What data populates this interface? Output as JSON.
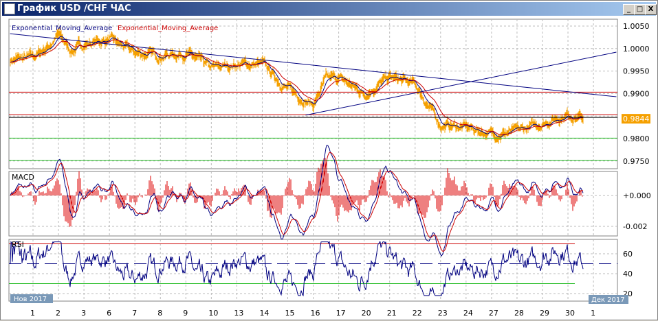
{
  "window": {
    "title": "График USD /CHF ЧАС",
    "minimize": "_",
    "maximize": "□",
    "close": "X"
  },
  "main": {
    "legend1": "Exponential_Moving_Average",
    "legend2": "Exponential_Moving_Average",
    "price_labels": [
      "1.0050",
      "1.0000",
      "0.9950",
      "0.9900",
      "0.9800",
      "0.9750"
    ],
    "price_values": [
      1.005,
      1.0,
      0.995,
      0.99,
      0.98,
      0.975
    ],
    "current_price": "0.9844",
    "colors": {
      "bars": "#f5a000",
      "ema1": "#000080",
      "ema2": "#cc0000",
      "current": "#f5a000"
    },
    "hlines": [
      {
        "price": 0.9903,
        "color": "#cc0000"
      },
      {
        "price": 0.9853,
        "color": "#cc0000"
      },
      {
        "price": 0.9847,
        "color": "#000000"
      },
      {
        "price": 0.9801,
        "color": "#22bb22"
      },
      {
        "price": 0.9752,
        "color": "#22bb22"
      }
    ],
    "trendlines": [
      {
        "from": [
          -0.9,
          1.0033
        ],
        "to": [
          22.9,
          0.9893
        ]
      },
      {
        "from": [
          10.7,
          0.9852
        ],
        "to": [
          22.9,
          0.9992
        ]
      }
    ]
  },
  "macd": {
    "label": "MACD",
    "tick_labels": [
      "+0.000",
      "-0.002"
    ]
  },
  "rsi": {
    "label": "RSI",
    "tick_labels": [
      "60",
      "40",
      "20"
    ],
    "levels": [
      70,
      50,
      30
    ]
  },
  "xaxis": {
    "month_left": "Нов 2017",
    "month_right": "Дек 2017",
    "days": [
      "1",
      "2",
      "3",
      "6",
      "7",
      "8",
      "9",
      "10",
      "13",
      "14",
      "15",
      "16",
      "17",
      "20",
      "21",
      "22",
      "23",
      "24",
      "27",
      "28",
      "29",
      "30",
      "1"
    ]
  },
  "chart_data": {
    "type": "line",
    "title": "USD/CHF H1",
    "price_anchors": [
      [
        -0.9,
        0.9975
      ],
      [
        0,
        0.998
      ],
      [
        0.6,
        1.0005
      ],
      [
        1,
        1.003
      ],
      [
        1.5,
        0.9995
      ],
      [
        2,
        1.001
      ],
      [
        3,
        1.002
      ],
      [
        4,
        0.999
      ],
      [
        5,
        0.9985
      ],
      [
        6,
        0.999
      ],
      [
        7,
        0.9955
      ],
      [
        8,
        0.9965
      ],
      [
        9,
        0.9965
      ],
      [
        10,
        0.991
      ],
      [
        11,
        0.9875
      ],
      [
        11.5,
        0.993
      ],
      [
        12,
        0.9935
      ],
      [
        13,
        0.99
      ],
      [
        14,
        0.9935
      ],
      [
        15,
        0.992
      ],
      [
        16,
        0.983
      ],
      [
        17,
        0.9825
      ],
      [
        18,
        0.981
      ],
      [
        19,
        0.9815
      ],
      [
        20,
        0.9835
      ],
      [
        21,
        0.9855
      ],
      [
        21.6,
        0.9844
      ]
    ]
  }
}
